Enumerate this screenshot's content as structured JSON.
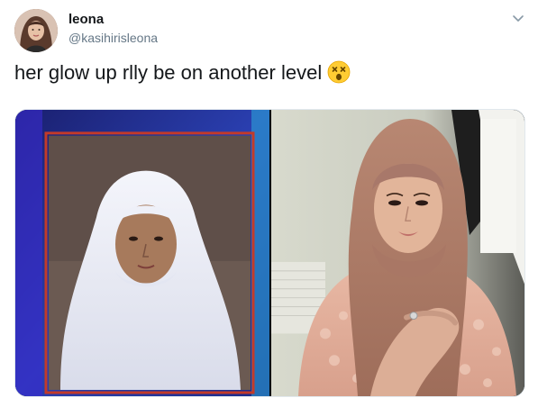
{
  "tweet": {
    "display_name": "leona",
    "handle": "@kasihirisleona",
    "text": "her glow up rlly be on another level",
    "emoji": "dizzy-face-emoji",
    "menu_icon": "chevron-down-icon"
  },
  "media": {
    "images": [
      {
        "name": "before-photo"
      },
      {
        "name": "after-photo"
      }
    ]
  },
  "colors": {
    "text": "#14171a",
    "secondary": "#657786",
    "border": "#e1e8ed"
  }
}
